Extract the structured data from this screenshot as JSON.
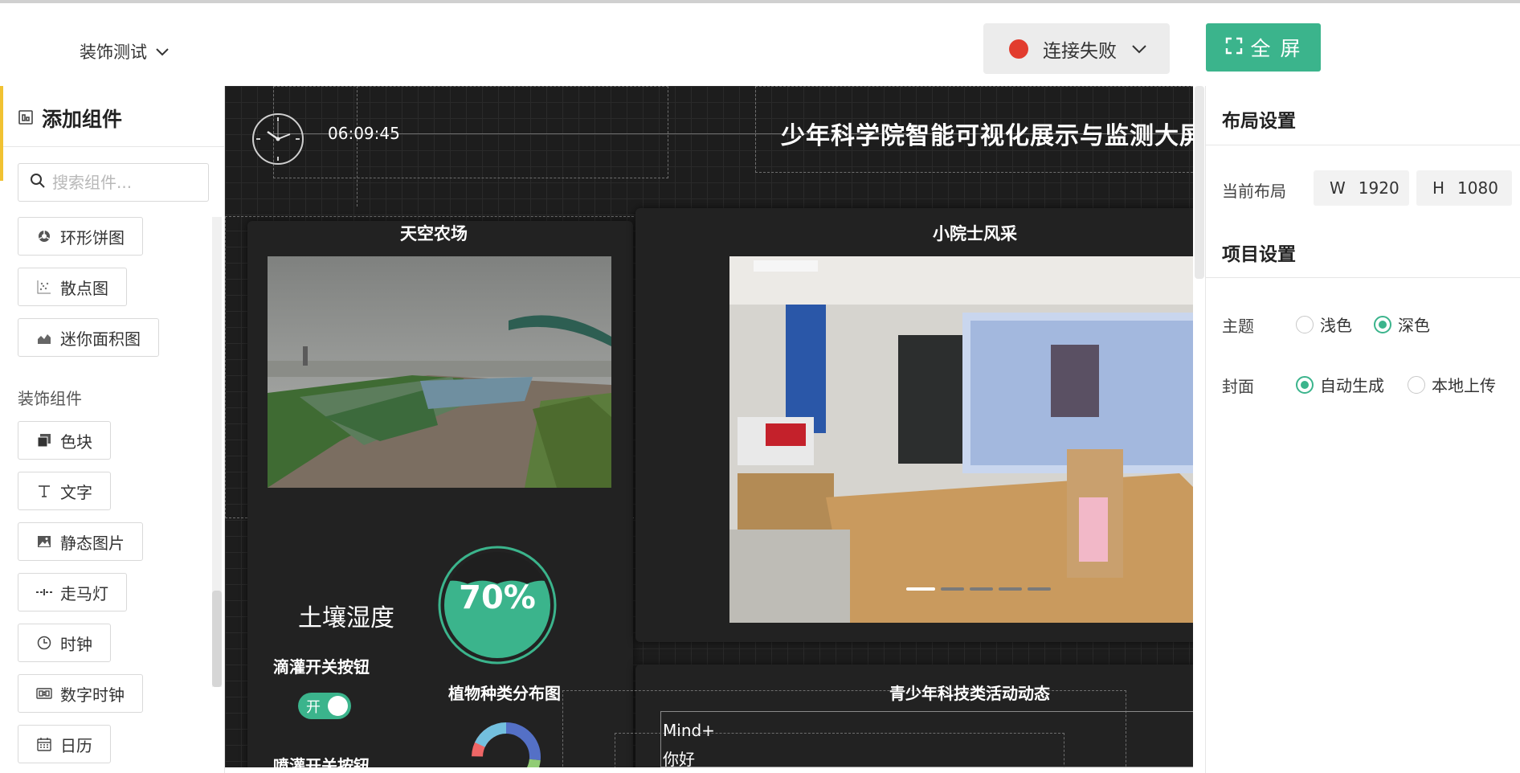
{
  "header": {
    "project_name": "装饰测试",
    "connection_status": "连接失败",
    "fullscreen_label": "全 屏",
    "status_color": "#e23c2e",
    "accent_color": "#3bb48c"
  },
  "left_panel": {
    "title": "添加组件",
    "search_placeholder": "搜索组件...",
    "chart_components": [
      {
        "label": "环形饼图",
        "icon": "ring-pie-icon"
      },
      {
        "label": "散点图",
        "icon": "scatter-icon"
      },
      {
        "label": "迷你面积图",
        "icon": "area-chart-icon"
      }
    ],
    "decor_section_label": "装饰组件",
    "decor_components": [
      {
        "label": "色块",
        "icon": "color-block-icon"
      },
      {
        "label": "文字",
        "icon": "text-icon"
      },
      {
        "label": "静态图片",
        "icon": "image-icon"
      },
      {
        "label": "走马灯",
        "icon": "marquee-icon"
      },
      {
        "label": "时钟",
        "icon": "clock-icon"
      },
      {
        "label": "数字时钟",
        "icon": "digital-clock-icon"
      },
      {
        "label": "日历",
        "icon": "calendar-icon"
      }
    ]
  },
  "canvas": {
    "time": "06:09:45",
    "title": "少年科学院智能可视化展示与监测大屏系",
    "farm_card_title": "天空农场",
    "class_card_title": "小院士风采",
    "soil_label": "土壤湿度",
    "soil_value": "70%",
    "soil_fraction": 0.7,
    "drip_switch_label": "滴灌开关按钮",
    "toggle_text": "开",
    "spray_switch_label": "喷灌开关按钮",
    "plant_chart_title": "植物种类分布图",
    "activity_title": "青少年科技类活动动态",
    "activity_items": [
      "Mind+",
      "你好"
    ],
    "carousel_active_index": 0,
    "carousel_count": 5
  },
  "right_panel": {
    "layout_title": "布局设置",
    "current_layout_label": "当前布局",
    "width_prefix": "W",
    "width_value": "1920",
    "height_prefix": "H",
    "height_value": "1080",
    "project_title": "项目设置",
    "theme_label": "主题",
    "theme_options": [
      "浅色",
      "深色"
    ],
    "theme_selected": "深色",
    "cover_label": "封面",
    "cover_options": [
      "自动生成",
      "本地上传"
    ],
    "cover_selected": "自动生成"
  }
}
